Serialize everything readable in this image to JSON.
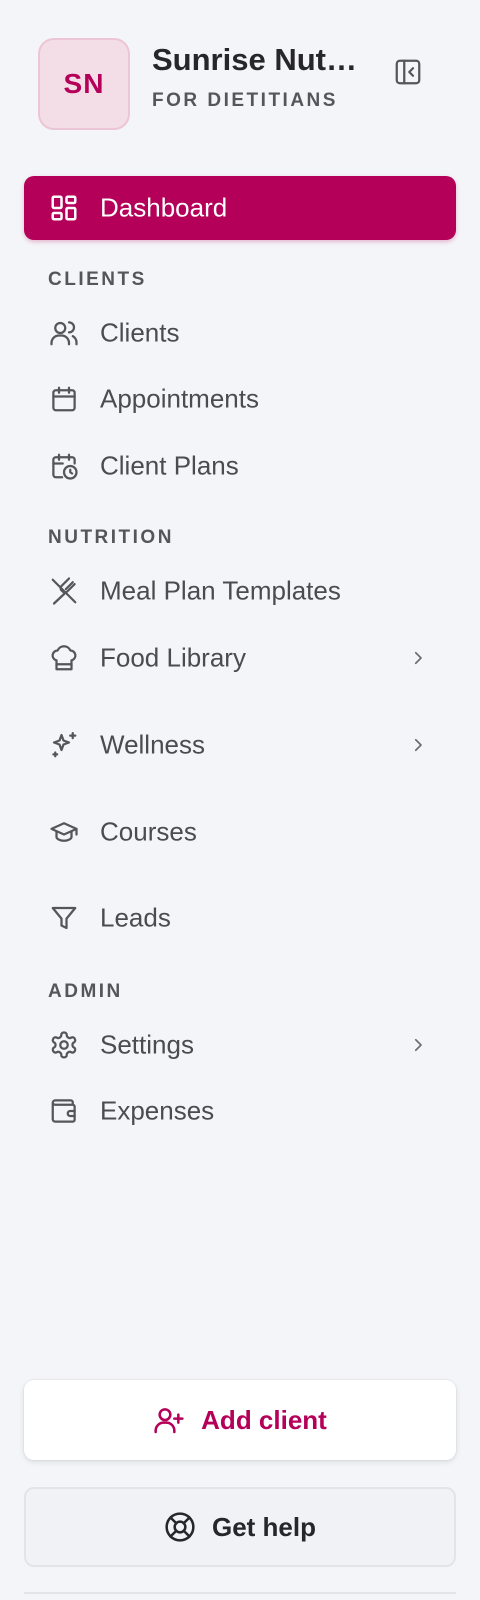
{
  "brand": {
    "initials": "SN",
    "name": "Sunrise Nutrition",
    "subtitle": "FOR DIETITIANS"
  },
  "nav": {
    "dashboard": "Dashboard",
    "sections": {
      "clients": "CLIENTS",
      "nutrition": "NUTRITION",
      "admin": "ADMIN"
    },
    "items": {
      "clients": "Clients",
      "appointments": "Appointments",
      "client_plans": "Client Plans",
      "meal_plan_templates": "Meal Plan Templates",
      "food_library": "Food Library",
      "wellness": "Wellness",
      "courses": "Courses",
      "leads": "Leads",
      "settings": "Settings",
      "expenses": "Expenses"
    }
  },
  "actions": {
    "add_client": "Add client",
    "get_help": "Get help"
  },
  "colors": {
    "accent": "#b5005a",
    "text": "#4b4b52",
    "background": "#f4f5f8"
  }
}
